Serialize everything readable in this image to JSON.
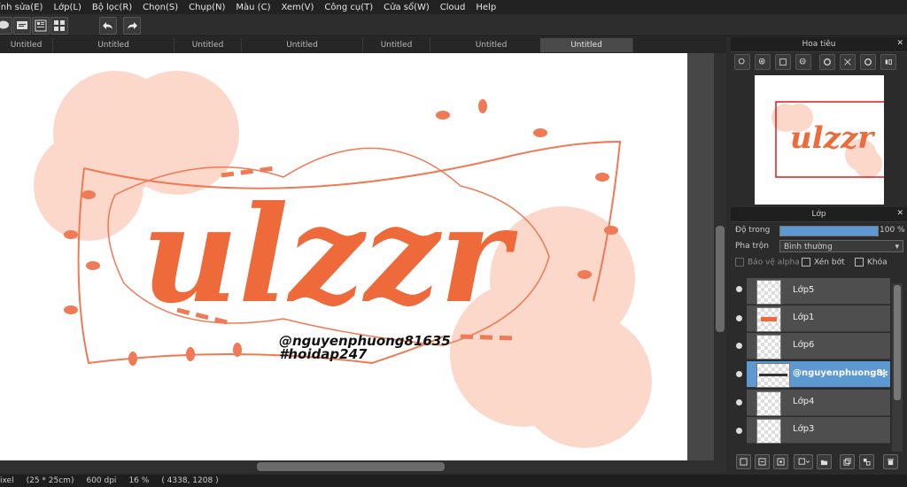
{
  "menu": [
    "ỉnh sửa(E)",
    "Lớp(L)",
    "Bộ lọc(R)",
    "Chọn(S)",
    "Chụp(N)",
    "Màu (C)",
    "Xem(V)",
    "Công cụ(T)",
    "Cửa sổ(W)",
    "Cloud",
    "Help"
  ],
  "tabs": [
    "Untitled",
    "Untitled",
    "Untitled",
    "Untitled",
    "Untitled",
    "Untitled",
    "Untitled"
  ],
  "canvas": {
    "title_text": "ulzzr",
    "handle": "@nguyenphuong81635",
    "hashtag": "#hoidap247"
  },
  "navigator": {
    "title": "Hoa tiêu"
  },
  "layers_panel": {
    "title": "Lớp",
    "opacity_label": "Độ trong",
    "opacity_value": "100 %",
    "blend_label": "Pha trộn",
    "blend_value": "Bình thường",
    "protect_alpha": "Bảo vệ alpha",
    "clipping": "Xén bớt",
    "lock": "Khóa",
    "layers": [
      {
        "name": "Lớp5",
        "selected": false
      },
      {
        "name": "Lớp1",
        "selected": false
      },
      {
        "name": "Lớp6",
        "selected": false
      },
      {
        "name": "@nguyenphuong8",
        "selected": true
      },
      {
        "name": "Lớp4",
        "selected": false
      },
      {
        "name": "Lớp3",
        "selected": false
      }
    ]
  },
  "status": {
    "unit": "ixel",
    "size": "(25 * 25cm)",
    "dpi": "600 dpi",
    "zoom": "16 %",
    "coords": "( 4338, 1208 )"
  },
  "colors": {
    "accent": "#5d98d0",
    "lettering": "#ef6a3a",
    "circle": "#f7b39a"
  }
}
